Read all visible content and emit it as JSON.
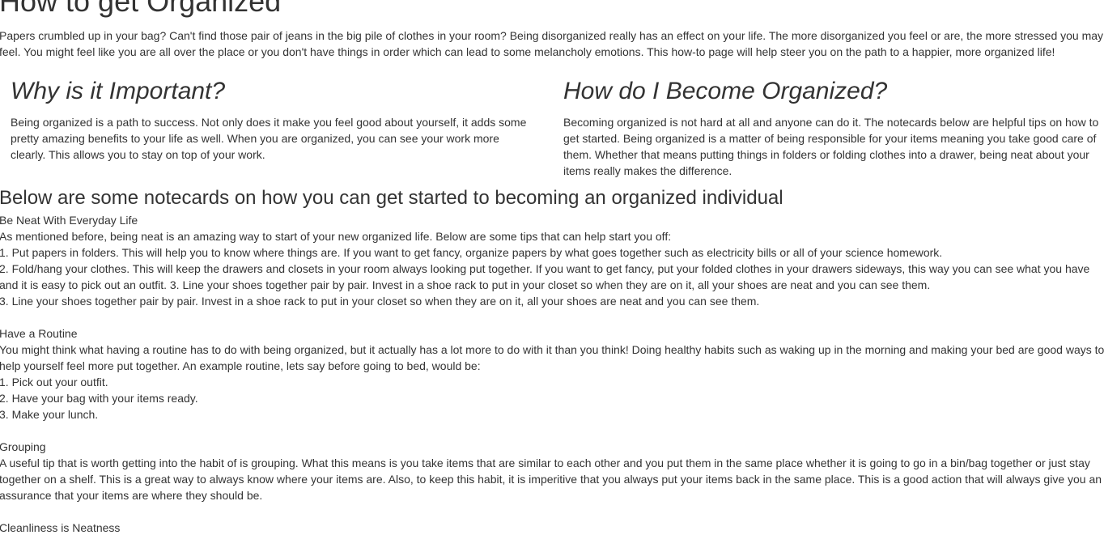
{
  "page": {
    "title": "How to get Organized",
    "intro": "Papers crumbled up in your bag? Can't find those pair of jeans in the big pile of clothes in your room? Being disorganized really has an effect on your life. The more disorganized you feel or are, the more stressed you may feel. You might feel like you are all over the place or you don't have things in order which can lead to some melancholy emotions. This how-to page will help steer you on the path to a happier, more organized life!"
  },
  "columns": [
    {
      "heading": "Why is it Important?",
      "text": "Being organized is a path to success. Not only does it make you feel good about yourself, it adds some pretty amazing benefits to your life as well. When you are organized, you can see your work more clearly. This allows you to stay on top of your work."
    },
    {
      "heading": "How do I Become Organized?",
      "text": "Becoming organized is not hard at all and anyone can do it. The notecards below are helpful tips on how to get started. Being organized is a matter of being responsible for your items meaning you take good care of them. Whether that means putting things in folders or folding clothes into a drawer, being neat about your items really makes the difference."
    }
  ],
  "notecards_heading": "Below are some notecards on how you can get started to becoming an organized individual",
  "cards": [
    {
      "title": "Be Neat With Everyday Life",
      "lines": [
        "As mentioned before, being neat is an amazing way to start of your new organized life. Below are some tips that can help start you off:",
        "1. Put papers in folders. This will help you to know where things are. If you want to get fancy, organize papers by what goes together such as electricity bills or all of your science homework.",
        "2. Fold/hang your clothes. This will keep the drawers and closets in your room always looking put together. If you want to get fancy, put your folded clothes in your drawers sideways, this way you can see what you have and it is easy to pick out an outfit. 3. Line your shoes together pair by pair. Invest in a shoe rack to put in your closet so when they are on it, all your shoes are neat and you can see them.",
        "3. Line your shoes together pair by pair. Invest in a shoe rack to put in your closet so when they are on it, all your shoes are neat and you can see them."
      ]
    },
    {
      "title": "Have a Routine",
      "lines": [
        "You might think what having a routine has to do with being organized, but it actually has a lot more to do with it than you think! Doing healthy habits such as waking up in the morning and making your bed are good ways to help yourself feel more put together. An example routine, lets say before going to bed, would be:",
        "1. Pick out your outfit.",
        "2. Have your bag with your items ready.",
        "3. Make your lunch."
      ]
    },
    {
      "title": "Grouping",
      "lines": [
        "A useful tip that is worth getting into the habit of is grouping. What this means is you take items that are similar to each other and you put them in the same place whether it is going to go in a bin/bag together or just stay together on a shelf. This is a great way to always know where your items are. Also, to keep this habit, it is imperitive that you always put your items back in the same place. This is a good action that will always give you an assurance that your items are where they should be."
      ]
    },
    {
      "title": "Cleanliness is Neatness",
      "lines": []
    }
  ]
}
